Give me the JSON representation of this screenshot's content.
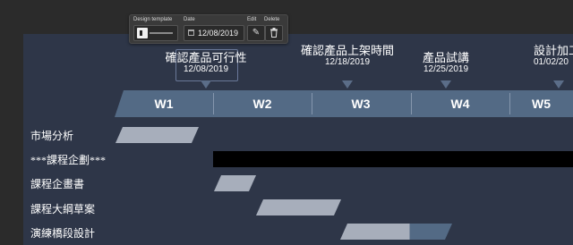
{
  "toolbar": {
    "design_template_label": "Design template",
    "date_label": "Date",
    "edit_label": "Edit",
    "delete_label": "Delete",
    "date_value": "12/08/2019"
  },
  "milestones": [
    {
      "title": "確認產品可行性",
      "date": "12/08/2019"
    },
    {
      "title": "確認產品上架時間",
      "date": "12/18/2019"
    },
    {
      "title": "產品試講",
      "date": "12/25/2019"
    },
    {
      "title": "設計加工",
      "date": "01/02/20"
    }
  ],
  "weeks": [
    "W1",
    "W2",
    "W3",
    "W4",
    "W5"
  ],
  "tasks": [
    {
      "label": "市場分析"
    },
    {
      "label": "***課程企劃***"
    },
    {
      "label": "課程企畫書"
    },
    {
      "label": "課程大綱草案"
    },
    {
      "label": "演練橋段設計"
    }
  ],
  "colors": {
    "slide_bg": "#2e3648",
    "week_band": "#536a85",
    "bar": "#a7aebb",
    "bar_progress": "#536a85",
    "summary_bar": "#000000"
  }
}
